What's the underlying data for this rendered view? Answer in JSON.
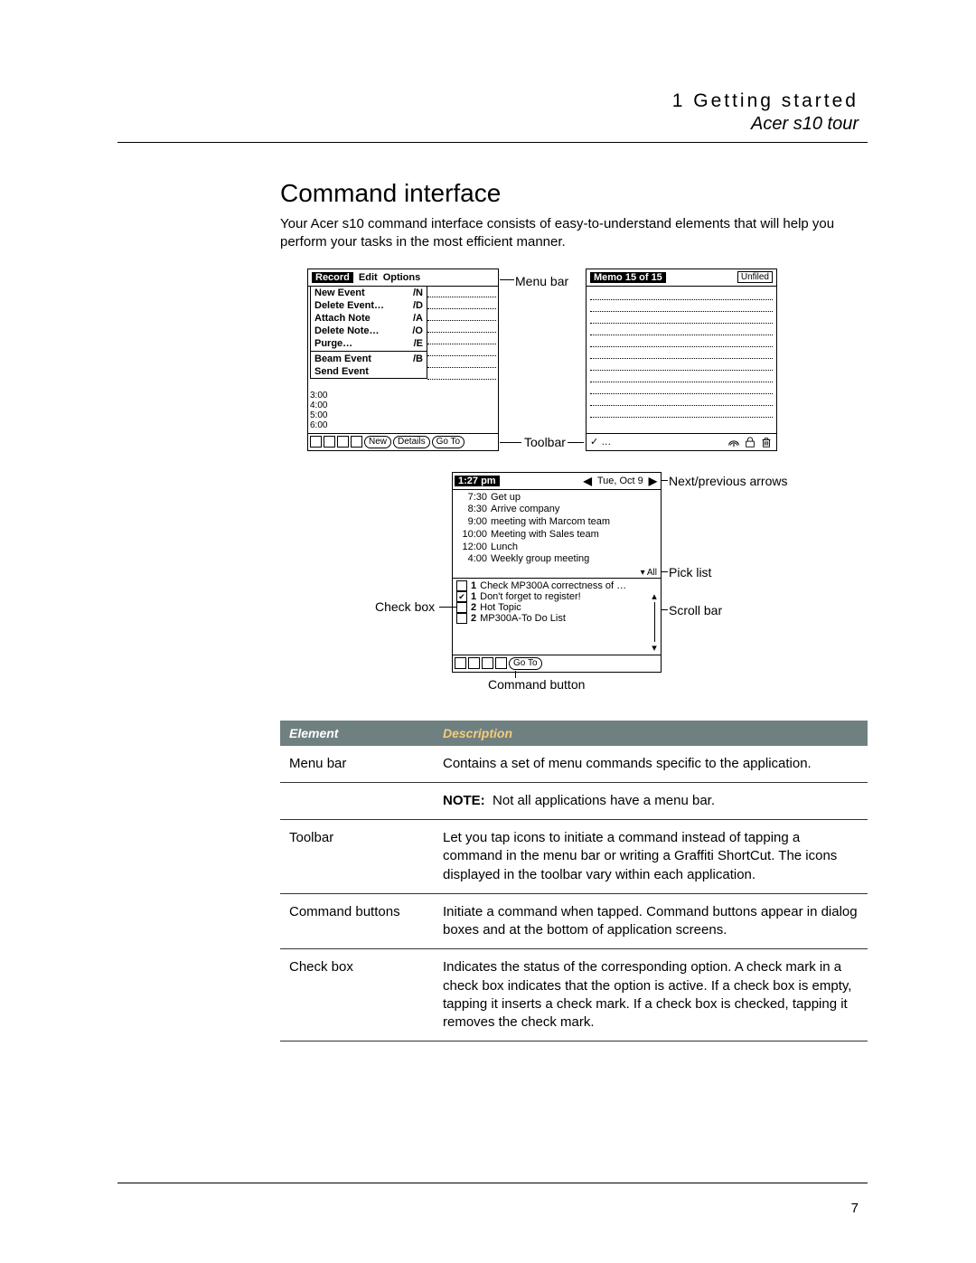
{
  "header": {
    "chapter": "1 Getting started",
    "subtitle": "Acer s10 tour"
  },
  "section": {
    "title": "Command interface",
    "intro": "Your Acer s10 command interface consists of easy-to-understand elements that will help you perform your tasks in the most efficient manner."
  },
  "labels": {
    "menu_bar": "Menu bar",
    "toolbar": "Toolbar",
    "next_prev": "Next/previous arrows",
    "pick_list": "Pick list",
    "scroll_bar": "Scroll bar",
    "check_box": "Check box",
    "command_button": "Command button"
  },
  "shot_left": {
    "menus": [
      "Record",
      "Edit",
      "Options"
    ],
    "menu_items": [
      {
        "label": "New Event",
        "sc": "/N"
      },
      {
        "label": "Delete Event…",
        "sc": "/D"
      },
      {
        "label": "Attach Note",
        "sc": "/A"
      },
      {
        "label": "Delete Note…",
        "sc": "/O"
      },
      {
        "label": "Purge…",
        "sc": "/E"
      },
      {
        "label": "Beam Event",
        "sc": "/B"
      },
      {
        "label": "Send Event",
        "sc": ""
      }
    ],
    "times": [
      "3:00",
      "4:00",
      "5:00",
      "6:00"
    ],
    "buttons": [
      "New",
      "Details",
      "Go To"
    ]
  },
  "shot_right": {
    "title": "Memo 15 of 15",
    "category": "Unfiled",
    "toolbar_left": "✓ …"
  },
  "shot_bottom": {
    "clock": "1:27 pm",
    "date": "Tue, Oct 9",
    "agenda": [
      {
        "time": "7:30",
        "text": "Get up"
      },
      {
        "time": "8:30",
        "text": "Arrive company"
      },
      {
        "time": "9:00",
        "text": "meeting with Marcom team"
      },
      {
        "time": "10:00",
        "text": "Meeting with Sales team"
      },
      {
        "time": "12:00",
        "text": "Lunch"
      },
      {
        "time": "4:00",
        "text": "Weekly group meeting"
      }
    ],
    "pick_list": "▾ All",
    "todo": [
      {
        "checked": false,
        "pri": "1",
        "text": "Check MP300A correctness of …"
      },
      {
        "checked": true,
        "pri": "1",
        "text": "Don't forget to register!"
      },
      {
        "checked": false,
        "pri": "2",
        "text": "Hot Topic"
      },
      {
        "checked": false,
        "pri": "2",
        "text": "MP300A-To Do List"
      }
    ],
    "button": "Go To"
  },
  "table": {
    "head": {
      "element": "Element",
      "description": "Description"
    },
    "rows": [
      {
        "element": "Menu bar",
        "description": "Contains a set of menu commands specific to the application.",
        "note_label": "NOTE:",
        "note": "Not all applications have a menu bar."
      },
      {
        "element": "Toolbar",
        "description": "Let you tap icons to initiate a command instead of tapping a command in the menu bar or writing a Graffiti ShortCut. The icons displayed in the toolbar vary within each application."
      },
      {
        "element": "Command buttons",
        "description": "Initiate a command when tapped. Command buttons appear in dialog boxes and at the bottom of application screens."
      },
      {
        "element": "Check box",
        "description": "Indicates the status of the corresponding option. A check mark in a check box indicates that the option is active. If a check box is empty, tapping it inserts a check mark. If a check box is checked, tapping it removes the check mark."
      }
    ]
  },
  "page_number": "7"
}
